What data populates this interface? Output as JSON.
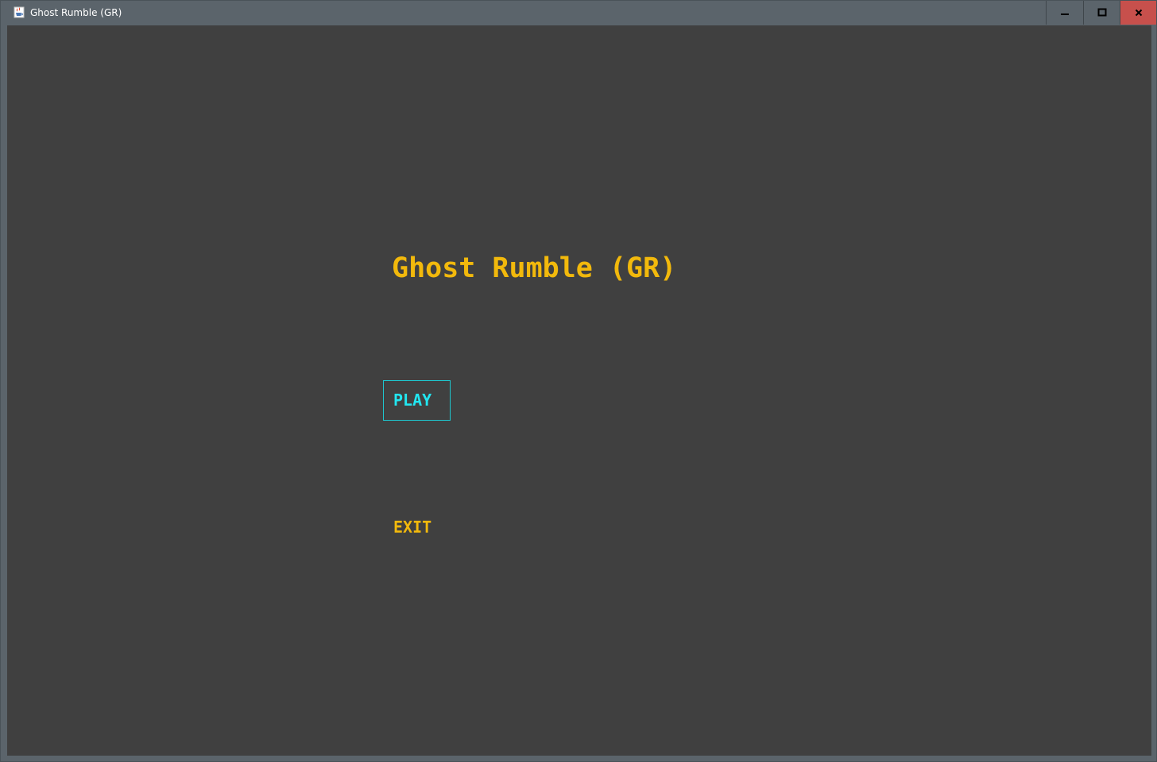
{
  "window": {
    "title": "Ghost Rumble (GR)",
    "app_icon": "java-cup-icon",
    "controls": {
      "minimize_icon": "minimize-icon",
      "maximize_icon": "maximize-icon",
      "close_icon": "close-icon"
    }
  },
  "game": {
    "title": "Ghost Rumble (GR)",
    "menu": [
      {
        "label": "PLAY",
        "selected": true
      },
      {
        "label": "EXIT",
        "selected": false
      }
    ]
  },
  "colors": {
    "background": "#404040",
    "frame": "#5b646b",
    "title": "#f2b90c",
    "menu_normal": "#f2b90c",
    "menu_selected": "#22e6f0",
    "close_button": "#c7504c"
  }
}
